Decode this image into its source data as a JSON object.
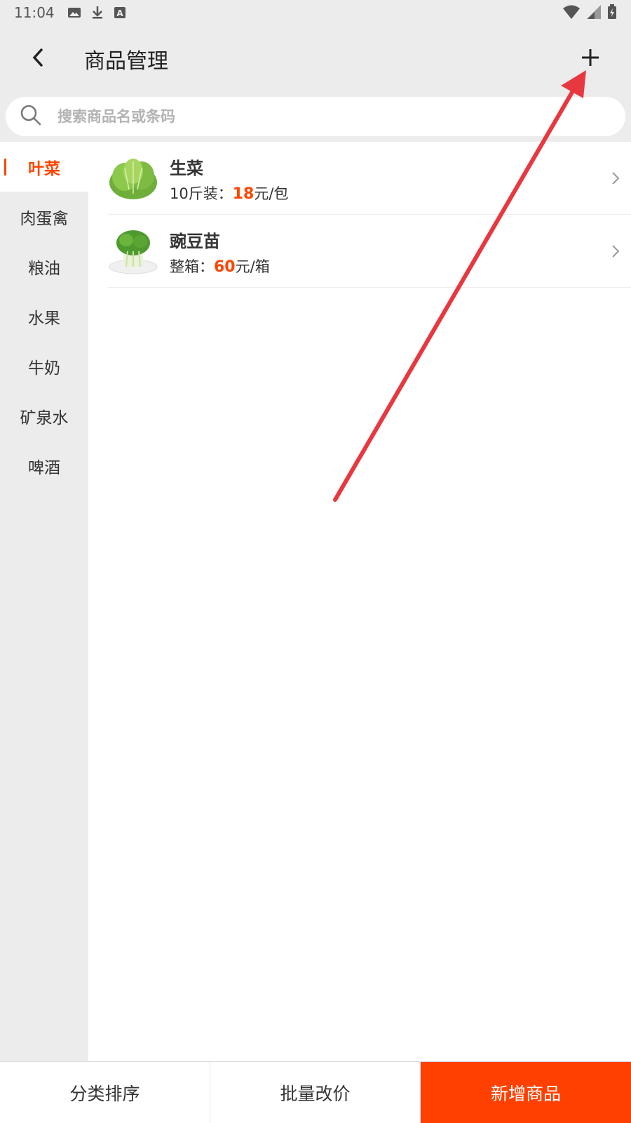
{
  "status_bar": {
    "time": "11:04",
    "left_icons": [
      "image-icon",
      "download-icon",
      "a-badge-icon"
    ],
    "right_icons": [
      "wifi-icon",
      "signal-icon",
      "battery-icon"
    ]
  },
  "header": {
    "title": "商品管理",
    "back_icon": "chevron-left-icon",
    "add_icon": "plus-icon"
  },
  "search": {
    "placeholder": "搜索商品名或条码",
    "icon": "search-icon"
  },
  "categories": [
    {
      "label": "叶菜",
      "active": true
    },
    {
      "label": "肉蛋禽",
      "active": false
    },
    {
      "label": "粮油",
      "active": false
    },
    {
      "label": "水果",
      "active": false
    },
    {
      "label": "牛奶",
      "active": false
    },
    {
      "label": "矿泉水",
      "active": false
    },
    {
      "label": "啤酒",
      "active": false
    }
  ],
  "products": [
    {
      "name": "生菜",
      "spec": "10斤装：",
      "price": "18",
      "unit": "元/包",
      "image": "lettuce-image"
    },
    {
      "name": "豌豆苗",
      "spec": "整箱：",
      "price": "60",
      "unit": "元/箱",
      "image": "pea-sprouts-image"
    }
  ],
  "bottom_bar": {
    "sort_label": "分类排序",
    "batch_price_label": "批量改价",
    "add_product_label": "新增商品"
  },
  "colors": {
    "accent": "#ff4500",
    "primary_button": "#ff4000",
    "annotation_arrow": "#e8383f",
    "background": "#ececec"
  }
}
